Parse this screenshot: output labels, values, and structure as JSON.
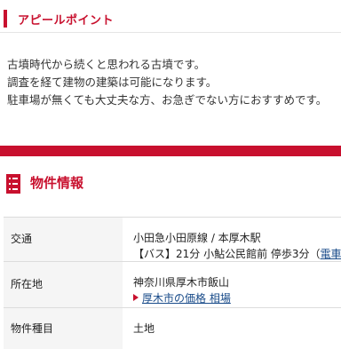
{
  "appeal": {
    "title": "アピールポイント",
    "lines": [
      "古墳時代から続くと思われる古墳です。",
      "調査を経て建物の建築は可能になります。",
      "駐車場が無くても大丈夫な方、お急ぎでない方におすすめです。"
    ]
  },
  "property_section": {
    "title": "物件情報",
    "icon": "document-list-icon"
  },
  "property_table": {
    "traffic": {
      "label": "交通",
      "line1": "小田急小田原線 / 本厚木駅",
      "line2_prefix": "【バス】21分 小鮎公民館前 停歩3分（",
      "line2_link": "電車ル"
    },
    "address": {
      "label": "所在地",
      "line1": "神奈川県厚木市飯山",
      "link": "厚木市の価格 相場"
    },
    "type": {
      "label": "物件種目",
      "value": "土地"
    }
  },
  "colors": {
    "accent": "#c8102e",
    "link": "#1a4c8a",
    "label_bg": "#f5f5f5"
  }
}
